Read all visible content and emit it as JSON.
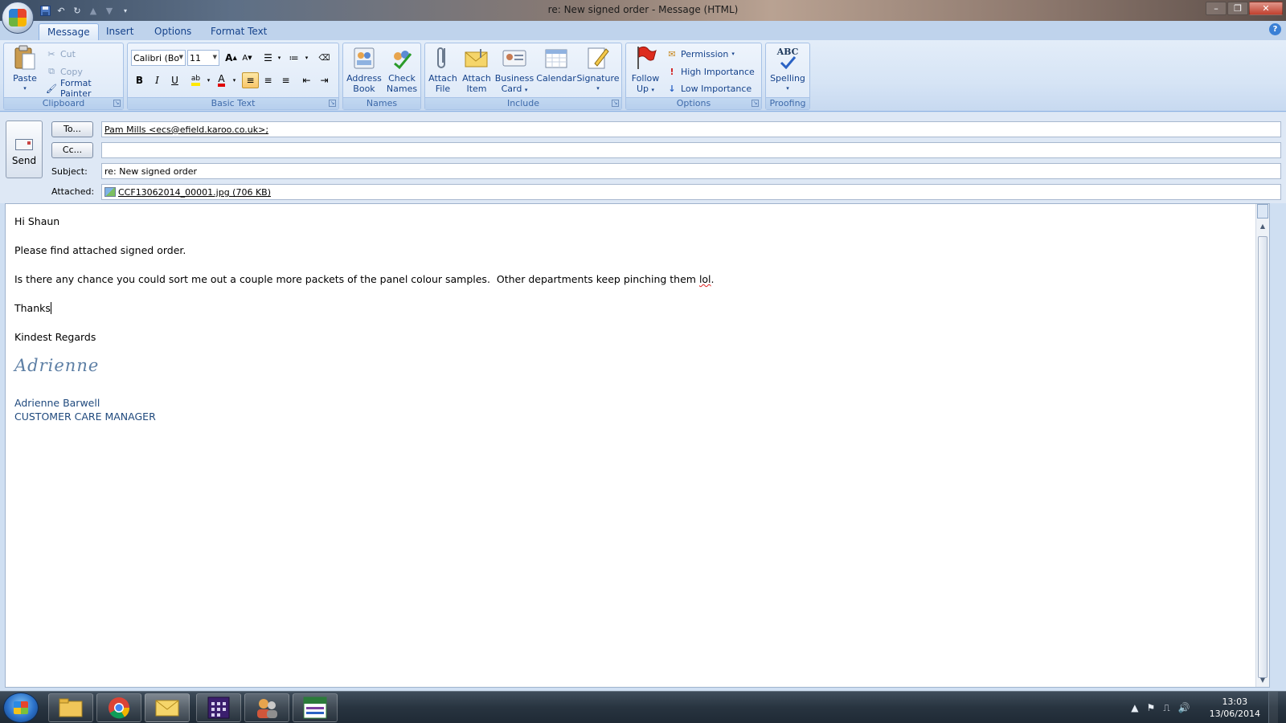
{
  "window": {
    "title": "re: New signed order - Message (HTML)",
    "minimize": "–",
    "maximize": "❐",
    "close": "✕"
  },
  "ribbon_tabs": [
    "Message",
    "Insert",
    "Options",
    "Format Text"
  ],
  "help": "?",
  "clipboard": {
    "paste": "Paste",
    "cut": "Cut",
    "copy": "Copy",
    "format_painter": "Format Painter",
    "label": "Clipboard"
  },
  "basic_text": {
    "font_name": "Calibri (Bo",
    "font_size": "11",
    "label": "Basic Text"
  },
  "names": {
    "address_book": [
      "Address",
      "Book"
    ],
    "check_names": [
      "Check",
      "Names"
    ],
    "label": "Names"
  },
  "include": {
    "attach_file": [
      "Attach",
      "File"
    ],
    "attach_item": [
      "Attach",
      "Item"
    ],
    "business_card": [
      "Business",
      "Card"
    ],
    "calendar": "Calendar",
    "signature": "Signature",
    "label": "Include"
  },
  "options": {
    "follow_up": [
      "Follow",
      "Up"
    ],
    "permission": "Permission",
    "high_importance": "High Importance",
    "low_importance": "Low Importance",
    "label": "Options"
  },
  "proofing": {
    "spelling": "Spelling",
    "abc": "ABC",
    "label": "Proofing"
  },
  "header": {
    "send": "Send",
    "to_button": "To...",
    "cc_button": "Cc...",
    "subject_label": "Subject:",
    "attached_label": "Attached:",
    "to_value": "Pam Mills <ecs@efield.karoo.co.uk>;",
    "cc_value": "",
    "subject_value": "re: New signed order",
    "attachment": "CCF13062014_00001.jpg (706 KB)"
  },
  "body": {
    "greeting": "Hi Shaun",
    "line1": "Please find attached signed order.",
    "line2_main": "Is there any chance you could sort me out a couple more packets of the panel colour samples.  Other departments keep pinching them ",
    "line2_misspelled": "lol",
    "line2_end": ".",
    "thanks": "Thanks",
    "regards": "Kindest Regards",
    "signature_script": "Adrienne",
    "sig_name": "Adrienne Barwell",
    "sig_title": "CUSTOMER CARE MANAGER"
  },
  "taskbar": {
    "time": "13:03",
    "date": "13/06/2014"
  },
  "colors": {
    "ribbon_text": "#15428b",
    "signature": "#1f497d"
  }
}
